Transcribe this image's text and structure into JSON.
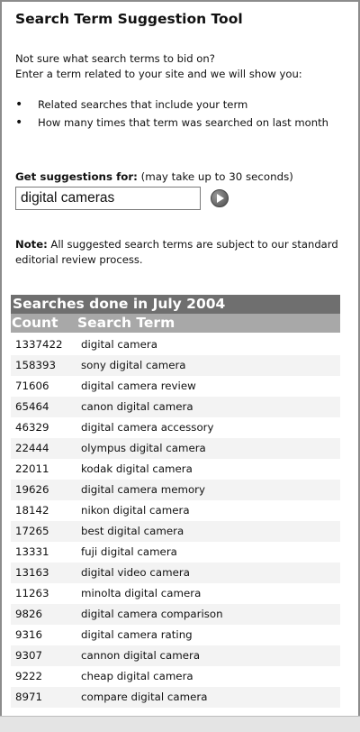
{
  "title": "Search Term Suggestion Tool",
  "intro": {
    "line1": "Not sure what search terms to bid on?",
    "line2": "Enter a term related to your site and we will show you:"
  },
  "bullets": [
    "Related searches that include your term",
    "How many times that term was searched on last month"
  ],
  "suggest": {
    "label": "Get suggestions for:",
    "hint": "(may take up to 30 seconds)",
    "input_value": "digital cameras"
  },
  "note": {
    "label": "Note:",
    "text": "All suggested search terms are subject to our standard editorial review process."
  },
  "results": {
    "heading": "Searches done in July 2004",
    "col_count": "Count",
    "col_term": "Search Term",
    "rows": [
      {
        "count": "1337422",
        "term": "digital camera"
      },
      {
        "count": "158393",
        "term": "sony digital camera"
      },
      {
        "count": "71606",
        "term": "digital camera review"
      },
      {
        "count": "65464",
        "term": "canon digital camera"
      },
      {
        "count": "46329",
        "term": "digital camera accessory"
      },
      {
        "count": "22444",
        "term": "olympus digital camera"
      },
      {
        "count": "22011",
        "term": "kodak digital camera"
      },
      {
        "count": "19626",
        "term": "digital camera memory"
      },
      {
        "count": "18142",
        "term": "nikon digital camera"
      },
      {
        "count": "17265",
        "term": "best digital camera"
      },
      {
        "count": "13331",
        "term": "fuji digital camera"
      },
      {
        "count": "13163",
        "term": "digital video camera"
      },
      {
        "count": "11263",
        "term": "minolta digital camera"
      },
      {
        "count": "9826",
        "term": "digital camera comparison"
      },
      {
        "count": "9316",
        "term": "digital camera rating"
      },
      {
        "count": "9307",
        "term": "cannon digital camera"
      },
      {
        "count": "9222",
        "term": "cheap digital camera"
      },
      {
        "count": "8971",
        "term": "compare digital camera"
      }
    ]
  }
}
